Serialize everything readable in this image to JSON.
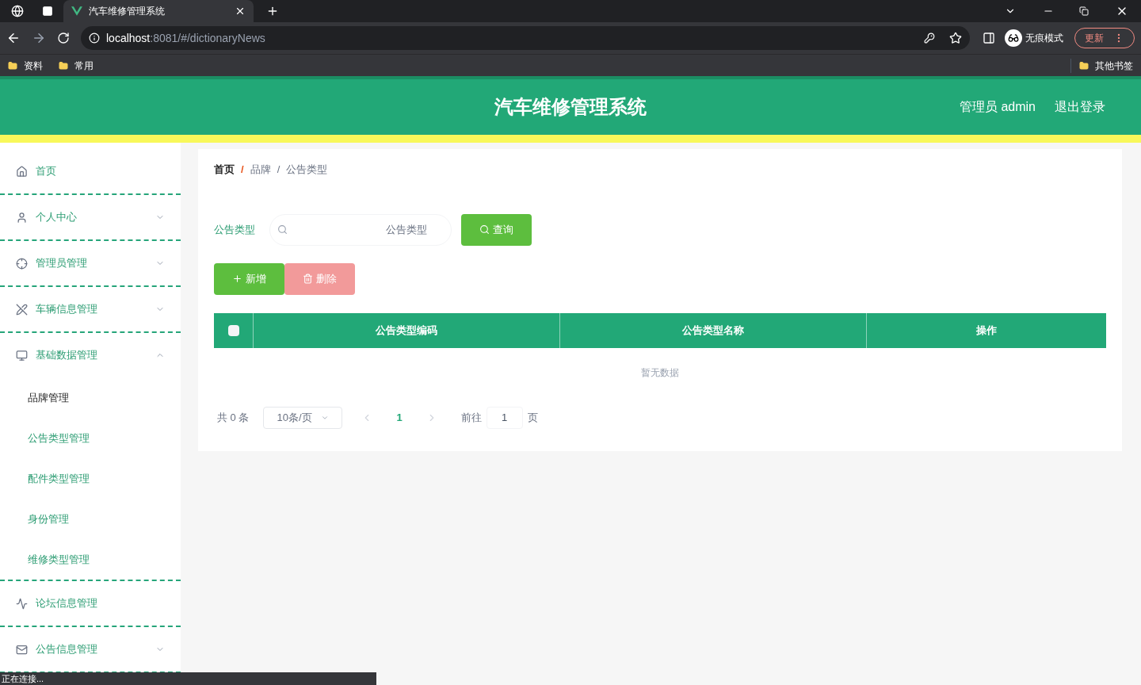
{
  "browser": {
    "tab_title": "汽车维修管理系统",
    "url_host": "localhost",
    "url_path": ":8081/#/dictionaryNews",
    "profile_label": "无痕模式",
    "update_button": "更新",
    "bookmarks": [
      "资料",
      "常用"
    ],
    "other_bookmarks": "其他书签"
  },
  "header": {
    "title": "汽车维修管理系统",
    "user": "管理员 admin",
    "logout": "退出登录"
  },
  "sidebar": {
    "items": [
      {
        "label": "首页",
        "has_arrow": false
      },
      {
        "label": "个人中心",
        "has_arrow": true,
        "expanded": false
      },
      {
        "label": "管理员管理",
        "has_arrow": true,
        "expanded": false
      },
      {
        "label": "车辆信息管理",
        "has_arrow": true,
        "expanded": false
      },
      {
        "label": "基础数据管理",
        "has_arrow": true,
        "expanded": true,
        "children": [
          {
            "label": "品牌管理",
            "selected": true
          },
          {
            "label": "公告类型管理",
            "selected": false
          },
          {
            "label": "配件类型管理",
            "selected": false
          },
          {
            "label": "身份管理",
            "selected": false
          },
          {
            "label": "维修类型管理",
            "selected": false
          }
        ]
      },
      {
        "label": "论坛信息管理",
        "has_arrow": false
      },
      {
        "label": "公告信息管理",
        "has_arrow": true,
        "expanded": false
      }
    ]
  },
  "breadcrumb": [
    {
      "label": "首页"
    },
    {
      "separator": "/",
      "label": "品牌"
    },
    {
      "separator": "/",
      "label": "公告类型"
    }
  ],
  "search": {
    "label": "公告类型",
    "placeholder": "公告类型",
    "button": "查询"
  },
  "actions": [
    {
      "label": "新增",
      "kind": "add",
      "disabled": false
    },
    {
      "label": "删除",
      "kind": "delete",
      "disabled": true
    }
  ],
  "table": {
    "select_all_checked": false,
    "columns": [
      "公告类型编码",
      "公告类型名称",
      "操作"
    ],
    "empty_text": "暂无数据"
  },
  "pagination": {
    "total": "共 0 条",
    "page_size": "10条/页",
    "current_page": "1",
    "goto_label": "前往",
    "goto_value": "1",
    "page_suffix": "页"
  },
  "status_bar": "正在连接..."
}
